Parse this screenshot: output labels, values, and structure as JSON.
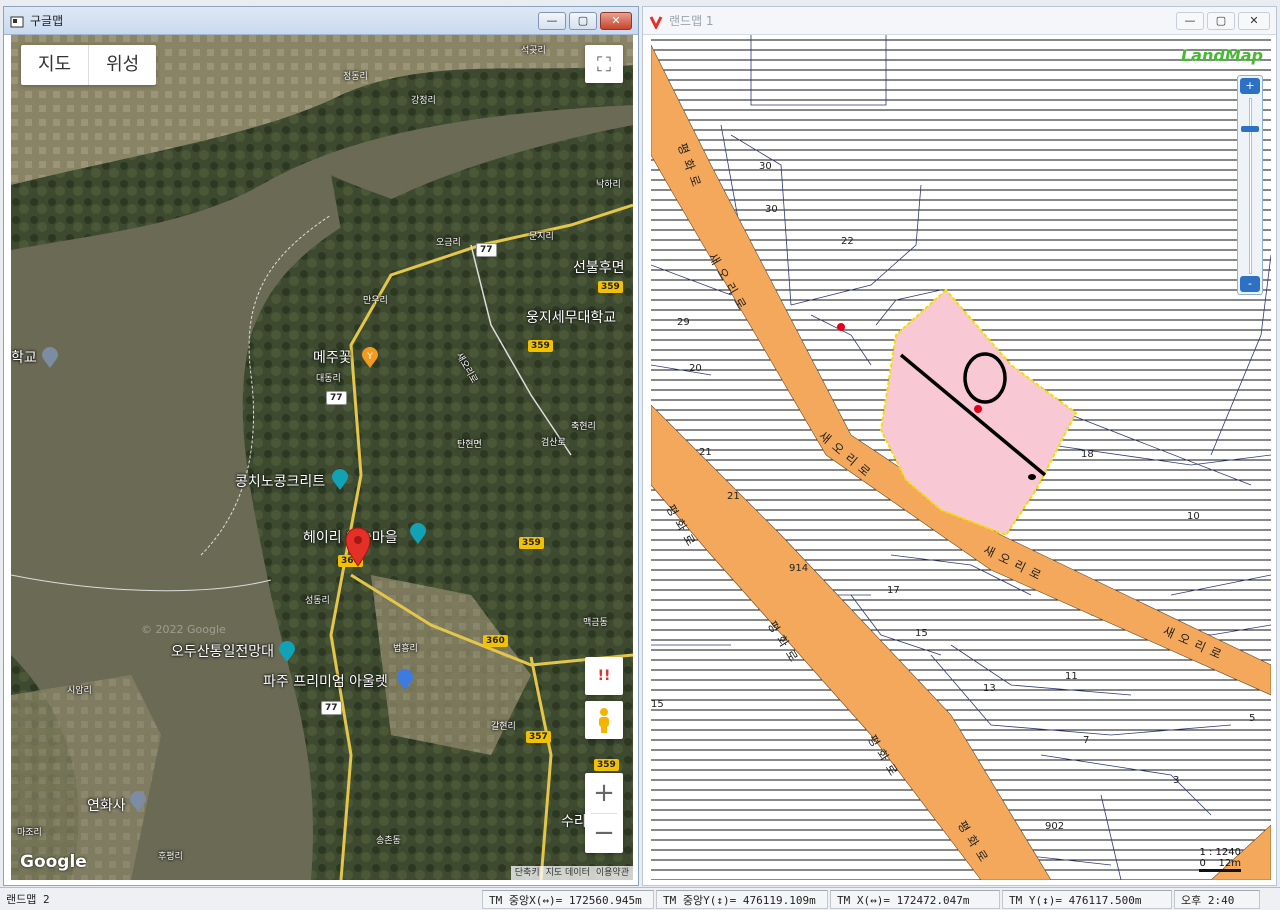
{
  "left_window": {
    "title": "구글맵",
    "buttons": {
      "minimize": "—",
      "maximize": "▢",
      "close": "✕"
    },
    "map_type": {
      "map": "지도",
      "satellite": "위성"
    },
    "labels": [
      {
        "text": "석곶리",
        "key": "l1"
      },
      {
        "text": "정동리",
        "key": "l2"
      },
      {
        "text": "강정리",
        "key": "l3"
      },
      {
        "text": "낙하리",
        "key": "l4"
      },
      {
        "text": "문지리",
        "key": "l5"
      },
      {
        "text": "오금리",
        "key": "l6"
      },
      {
        "text": "선불후면",
        "key": "l7"
      },
      {
        "text": "만우리",
        "key": "l8"
      },
      {
        "text": "웅지세무대학교",
        "key": "l9"
      },
      {
        "text": "학교",
        "key": "l10"
      },
      {
        "text": "메주꽃",
        "key": "l11"
      },
      {
        "text": "대동리",
        "key": "l12"
      },
      {
        "text": "새오리로",
        "key": "l13"
      },
      {
        "text": "축현리",
        "key": "l14"
      },
      {
        "text": "탄현면",
        "key": "l15"
      },
      {
        "text": "검산로",
        "key": "l16"
      },
      {
        "text": "콩치노콩크리트",
        "key": "l17"
      },
      {
        "text": "헤이리 예술마을",
        "key": "l18"
      },
      {
        "text": "성동리",
        "key": "l19"
      },
      {
        "text": "맥금동",
        "key": "l20"
      },
      {
        "text": "오두산통일전망대",
        "key": "l21"
      },
      {
        "text": "법흥리",
        "key": "l22"
      },
      {
        "text": "파주 프리미엄 아울렛",
        "key": "l23"
      },
      {
        "text": "시암리",
        "key": "l24"
      },
      {
        "text": "갈현리",
        "key": "l25"
      },
      {
        "text": "연화사",
        "key": "l26"
      },
      {
        "text": "마조리",
        "key": "l27"
      },
      {
        "text": "후평리",
        "key": "l28"
      },
      {
        "text": "송촌동",
        "key": "l29"
      },
      {
        "text": "수리",
        "key": "l30"
      }
    ],
    "shields": [
      "77",
      "359",
      "359",
      "77",
      "360",
      "359",
      "360",
      "357",
      "359",
      "77"
    ],
    "google_logo": "Google",
    "watermark": "© 2022 Google",
    "attribution": [
      "단축키",
      "지도 데이터",
      "이용약관"
    ],
    "controls": {
      "fullscreen": "⛶",
      "alert": "!!",
      "zoom_in": "+",
      "zoom_out": "−"
    }
  },
  "right_window": {
    "title": "랜드맵 1",
    "buttons": {
      "minimize": "—",
      "maximize": "▢",
      "close": "✕"
    },
    "logo": "LandMap",
    "zoom": {
      "plus": "+",
      "minus": "-"
    },
    "scale_ratio": "1 : 1240",
    "scale_bar": "0    12m",
    "parcel_numbers": [
      "30",
      "30",
      "22",
      "29",
      "20",
      "21",
      "21",
      "18",
      "10",
      "914",
      "17",
      "15",
      "13",
      "11",
      "5",
      "7",
      "3",
      "902",
      "15"
    ],
    "road_labels": [
      "새오리로",
      "새오리로",
      "새오리로",
      "새오리로",
      "평화로",
      "평화로",
      "평화로",
      "평화로",
      "평화로"
    ]
  },
  "statusbar": {
    "app": "랜드맵 2",
    "tm_center_x": "TM 중앙X(↔)= 172560.945m",
    "tm_center_y": "TM 중앙Y(↕)= 476119.109m",
    "tm_x": "TM X(↔)= 172472.047m",
    "tm_y": "TM Y(↕)= 476117.500m",
    "clock": "오후 2:40"
  }
}
